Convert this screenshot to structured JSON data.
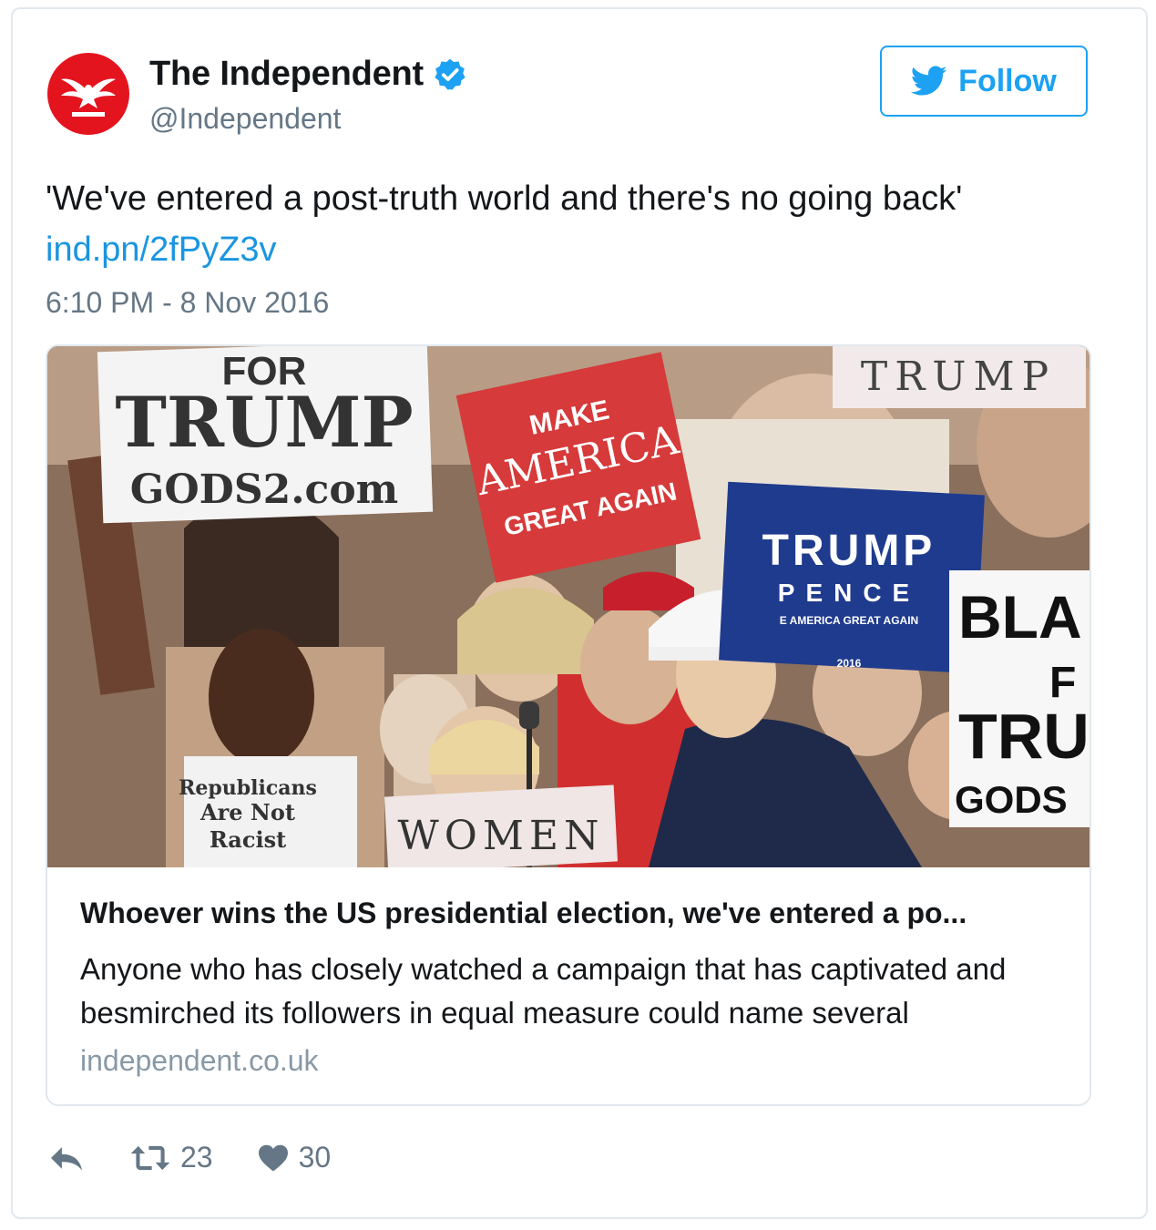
{
  "author": {
    "display_name": "The Independent",
    "handle": "@Independent",
    "verified": true,
    "avatar_icon": "eagle-logo-icon",
    "avatar_color": "#e4141e"
  },
  "follow_button": {
    "label": "Follow",
    "icon": "twitter-bird-icon",
    "color": "#1da1f2"
  },
  "tweet": {
    "text": "'We've entered a post-truth world and there's no going back'",
    "link": "ind.pn/2fPyZ3v",
    "timestamp": "6:10 PM - 8 Nov 2016"
  },
  "card": {
    "image_signs": {
      "for": "FOR",
      "trump_big": "TRUMP",
      "gods_site": "GODS2.com",
      "make": "MAKE",
      "america": "AMERICA",
      "great_again": "GREAT AGAIN",
      "trump_top": "TRUMP",
      "trump_blue": "TRUMP",
      "pence": "PENCE",
      "make_america_small": "E AMERICA GREAT AGAIN",
      "year": "2016",
      "bla": "BLA",
      "fo": "F",
      "tru": "TRU",
      "gods_right": "GODS",
      "women": "WOMEN",
      "shirt_line1": "Republicans",
      "shirt_line2": "Are Not",
      "shirt_line3": "Racist"
    },
    "title": "Whoever wins the US presidential election, we've entered a po...",
    "description": "Anyone who has closely watched a campaign that has captivated and besmirched its followers in equal measure could name several",
    "domain": "independent.co.uk"
  },
  "actions": {
    "reply_icon": "reply-icon",
    "retweet_icon": "retweet-icon",
    "retweet_count": "23",
    "like_icon": "heart-icon",
    "like_count": "30",
    "icon_color": "#657786"
  }
}
